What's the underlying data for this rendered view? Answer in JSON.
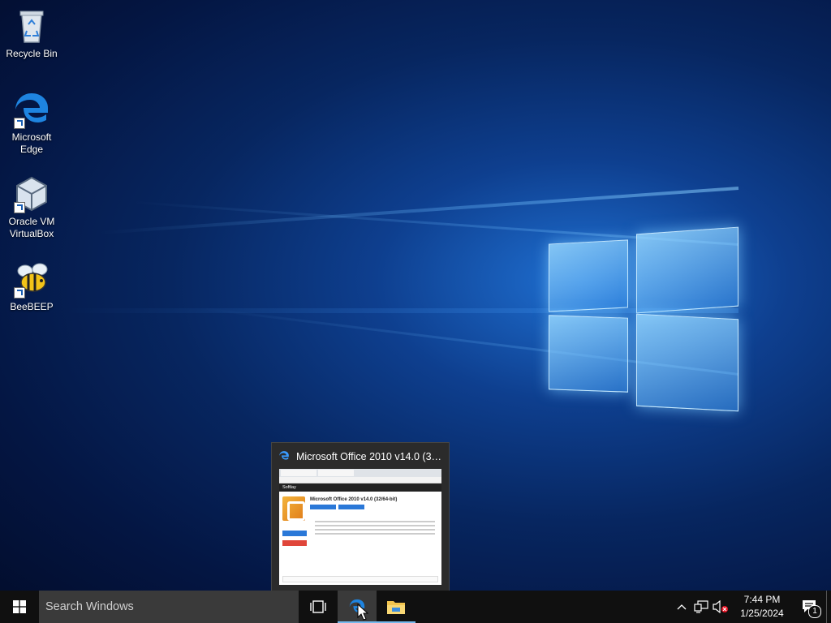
{
  "desktop": {
    "icons": [
      {
        "label": "Recycle Bin"
      },
      {
        "label": "Microsoft Edge"
      },
      {
        "label": "Oracle VM VirtualBox"
      },
      {
        "label": "BeeBEEP"
      }
    ]
  },
  "thumbnail": {
    "title": "Microsoft Office 2010 v14.0 (32/...",
    "page": {
      "site": "Softlay",
      "heading": "Microsoft Office 2010 v14.0 (32/64-bit)"
    }
  },
  "taskbar": {
    "search_placeholder": "Search Windows",
    "clock": {
      "time": "7:44 PM",
      "date": "1/25/2024"
    },
    "notification_count": "1"
  },
  "colors": {
    "accent": "#76b9ed",
    "taskbar": "#101010",
    "search_box": "#3a3a3a"
  }
}
